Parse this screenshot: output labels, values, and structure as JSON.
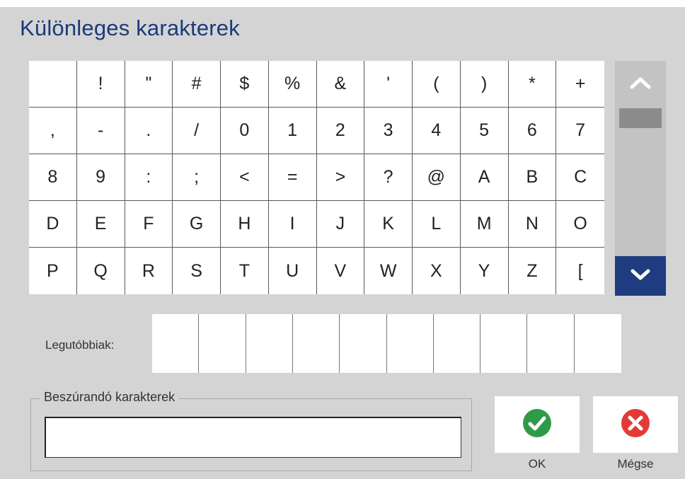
{
  "dialog": {
    "title": "Különleges karakterek"
  },
  "characters": [
    "",
    "!",
    "\"",
    "#",
    "$",
    "%",
    "&",
    "'",
    "(",
    ")",
    "*",
    "+",
    ",",
    "-",
    ".",
    "/",
    "0",
    "1",
    "2",
    "3",
    "4",
    "5",
    "6",
    "7",
    "8",
    "9",
    ":",
    ";",
    "<",
    "=",
    ">",
    "?",
    "@",
    "A",
    "B",
    "C",
    "D",
    "E",
    "F",
    "G",
    "H",
    "I",
    "J",
    "K",
    "L",
    "M",
    "N",
    "O",
    "P",
    "Q",
    "R",
    "S",
    "T",
    "U",
    "V",
    "W",
    "X",
    "Y",
    "Z",
    "["
  ],
  "recent": {
    "label": "Legutóbbiak:",
    "slots": 10
  },
  "insert": {
    "legend": "Beszúrandó karakterek",
    "value": ""
  },
  "buttons": {
    "ok_label": "OK",
    "cancel_label": "Mégse"
  },
  "icons": {
    "scroll_up": "chevron-up-icon",
    "scroll_down": "chevron-down-icon",
    "ok": "check-circle-icon",
    "cancel": "x-circle-icon"
  },
  "colors": {
    "title": "#1a3a7c",
    "scroll_down_bg": "#1f3c80",
    "ok_icon": "#2e9b49",
    "cancel_icon": "#e23b36"
  }
}
